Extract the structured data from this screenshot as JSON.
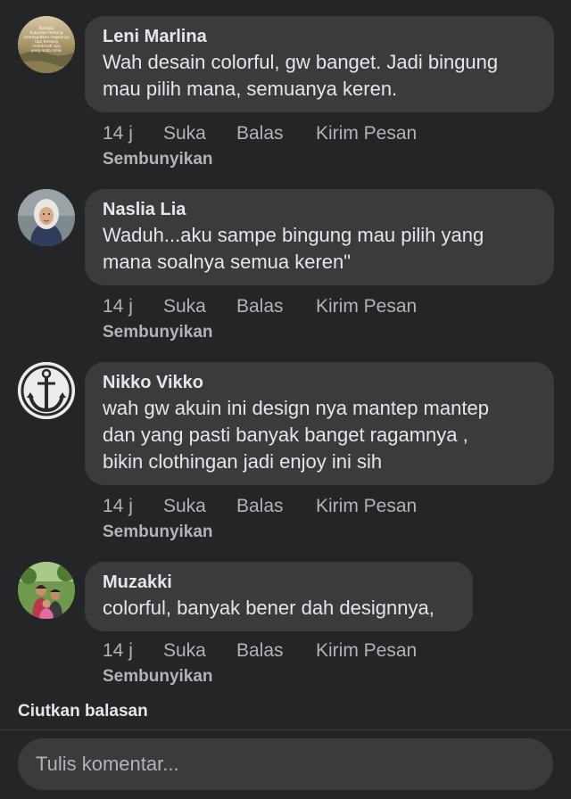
{
  "comments": [
    {
      "author": "Leni Marlina",
      "lines": [
        "Wah desain colorful, gw banget. Jadi bingung",
        "mau pilih mana, semuanya keren."
      ],
      "time": "14 j",
      "like": "Suka",
      "reply": "Balas",
      "message": "Kirim Pesan",
      "hide": "Sembunyikan",
      "avatar_icon": "landscape-quote-photo",
      "avatar_lines": [
        "Bahagia",
        "bukanlah tentang",
        "mendapatkan segalanya",
        "tapi tentang",
        "menikmati apa",
        "yang anda miliki"
      ]
    },
    {
      "author": "Naslia Lia",
      "lines": [
        "Waduh...aku sampe bingung mau pilih yang",
        "mana soalnya semua keren\""
      ],
      "time": "14 j",
      "like": "Suka",
      "reply": "Balas",
      "message": "Kirim Pesan",
      "hide": "Sembunyikan",
      "avatar_icon": "hijab-woman-photo"
    },
    {
      "author": "Nikko Vikko",
      "lines": [
        "wah gw akuin ini design nya mantep mantep",
        "dan yang pasti banyak banget ragamnya ,",
        "bikin clothingan jadi enjoy ini sih"
      ],
      "time": "14 j",
      "like": "Suka",
      "reply": "Balas",
      "message": "Kirim Pesan",
      "hide": "Sembunyikan",
      "avatar_icon": "anchor-logo"
    },
    {
      "author": "Muzakki",
      "lines": [
        "colorful, banyak bener dah designnya,"
      ],
      "time": "14 j",
      "like": "Suka",
      "reply": "Balas",
      "message": "Kirim Pesan",
      "hide": "Sembunyikan",
      "avatar_icon": "family-outdoor-photo"
    }
  ],
  "collapse_replies": "Ciutkan balasan",
  "composer": {
    "placeholder": "Tulis komentar..."
  },
  "colors": {
    "background": "#242526",
    "bubble": "#3a3b3c",
    "primary_text": "#e4e6eb",
    "secondary_text": "#b0b3b8"
  }
}
